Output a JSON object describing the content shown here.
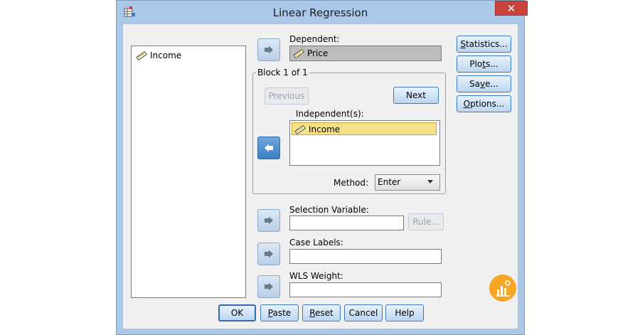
{
  "window": {
    "title": "Linear Regression",
    "close_symbol": "✕"
  },
  "source_list": {
    "items": [
      {
        "label": "Income",
        "icon": "scale-variable-icon"
      }
    ]
  },
  "dependent": {
    "label": "Dependent:",
    "value": "Price"
  },
  "block": {
    "title": "Block 1 of 1",
    "previous_label": "Previous",
    "next_label": "Next",
    "independents_label": "Independent(s):",
    "independents": [
      {
        "label": "Income"
      }
    ],
    "method_label": "Method:",
    "method_value": "Enter"
  },
  "selection_variable": {
    "label": "Selection Variable:",
    "rule_label": "Rule...",
    "value": ""
  },
  "case_labels": {
    "label": "Case Labels:",
    "value": ""
  },
  "wls_weight": {
    "label": "WLS Weight:",
    "value": ""
  },
  "side_buttons": [
    {
      "pre": "",
      "key": "S",
      "post": "tatistics..."
    },
    {
      "pre": "Plo",
      "key": "t",
      "post": "s..."
    },
    {
      "pre": "Sa",
      "key": "v",
      "post": "e..."
    },
    {
      "pre": "",
      "key": "O",
      "post": "ptions..."
    }
  ],
  "bottom_buttons": [
    {
      "pre": "OK",
      "key": "",
      "post": ""
    },
    {
      "pre": "",
      "key": "P",
      "post": "aste"
    },
    {
      "pre": "",
      "key": "R",
      "post": "eset"
    },
    {
      "pre": "Cancel",
      "key": "",
      "post": ""
    },
    {
      "pre": "Help",
      "key": "",
      "post": ""
    }
  ],
  "colors": {
    "selected_highlight": "#f7e08a",
    "dependent_bg": "#bdbdbd",
    "window_frame": "#a9c8ea",
    "badge": "#f6a623"
  }
}
